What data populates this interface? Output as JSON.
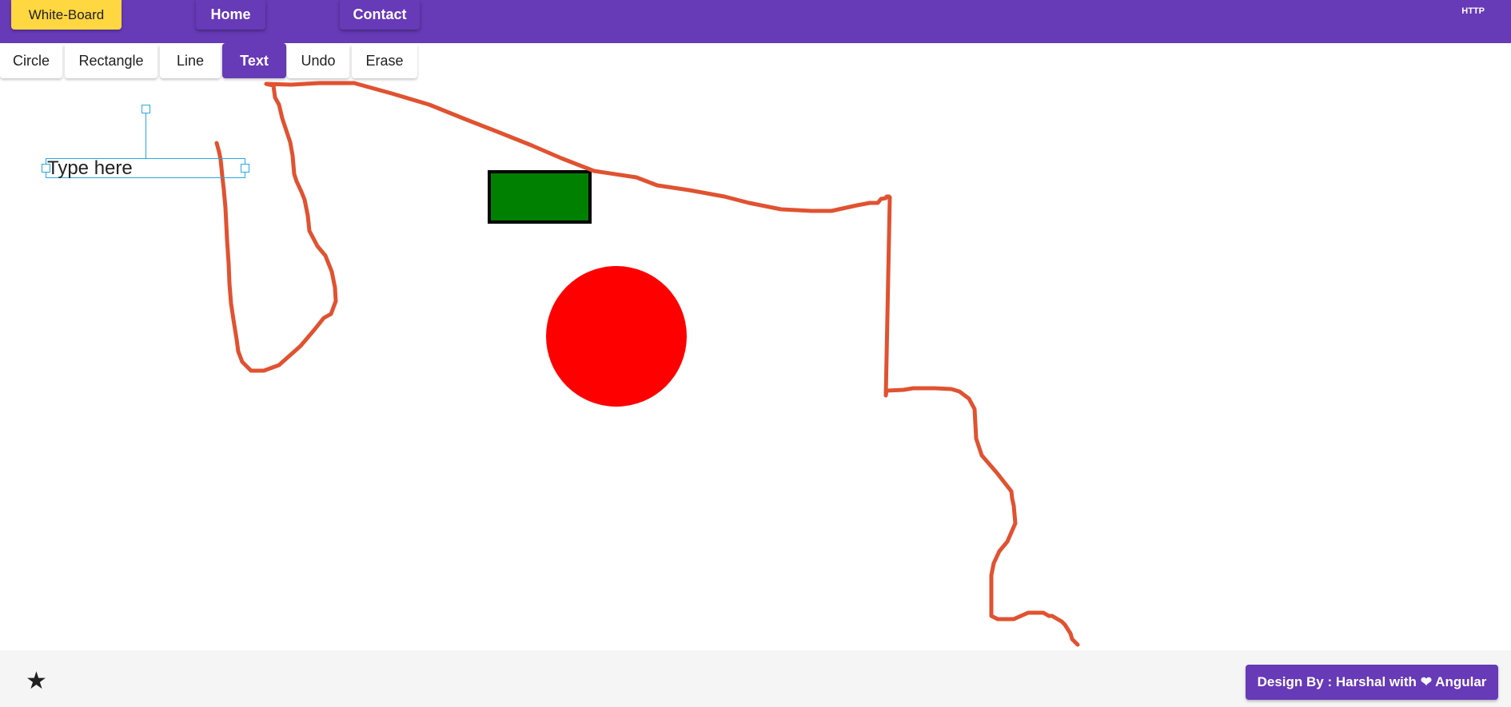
{
  "header": {
    "brand_label": "White-Board",
    "nav": [
      {
        "label": "Home"
      },
      {
        "label": "Contact"
      }
    ],
    "right_label": "HTTP",
    "background_color": "#673ab7",
    "brand_color": "#ffd740"
  },
  "toolbar": {
    "tools": [
      {
        "label": "Circle",
        "active": false
      },
      {
        "label": "Rectangle",
        "active": false
      },
      {
        "label": "Line",
        "active": false
      },
      {
        "label": "Text",
        "active": true
      },
      {
        "label": "Undo",
        "active": false
      },
      {
        "label": "Erase",
        "active": false
      }
    ]
  },
  "canvas": {
    "text_placeholder": "Type here",
    "shapes": [
      {
        "type": "rectangle",
        "fill": "#008000",
        "stroke": "#000000"
      },
      {
        "type": "circle",
        "fill": "#ff0000"
      },
      {
        "type": "freehand-line",
        "stroke": "#e05231"
      }
    ]
  },
  "footer": {
    "star_icon": "star-icon",
    "credit_prefix": "Design By : Harshal with",
    "credit_icon": "heart-icon",
    "credit_suffix": "Angular"
  }
}
